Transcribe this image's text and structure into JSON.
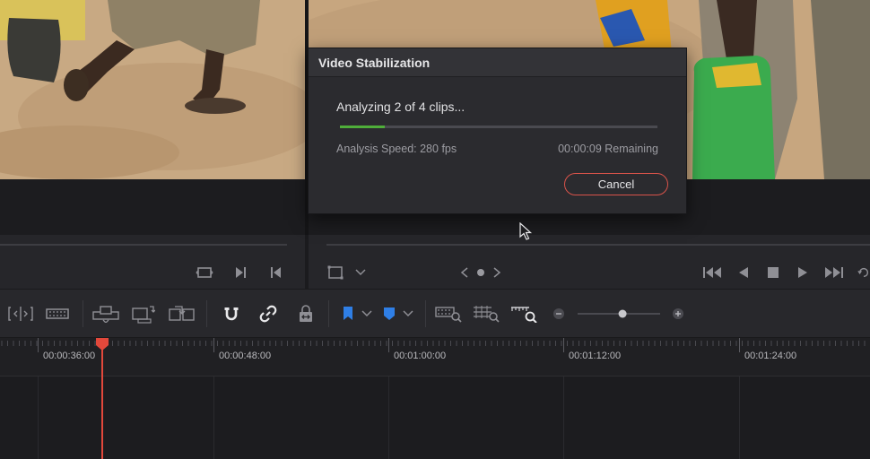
{
  "dialog": {
    "title": "Video Stabilization",
    "status": "Analyzing 2 of 4 clips...",
    "progress_fraction": 0.14,
    "speed_label": "Analysis Speed: 280 fps",
    "remaining_label": "00:00:09 Remaining",
    "cancel_label": "Cancel"
  },
  "source_viewer": {
    "icons": [
      "fit-frame-icon",
      "match-frame-icon",
      "prev-edit-icon"
    ]
  },
  "timeline_viewer": {
    "icons": [
      "transform-icon",
      "chevron-down-icon",
      "prev-arrow-icon",
      "dot-indicator-icon",
      "next-arrow-icon",
      "jump-start-icon",
      "play-reverse-icon",
      "stop-icon",
      "play-icon",
      "jump-end-icon",
      "loop-icon"
    ]
  },
  "toolbar": {
    "icons": [
      "trim-edit-icon",
      "dynamic-trim-icon",
      "insert-clip-icon",
      "overwrite-clip-icon",
      "replace-clip-icon",
      "snapping-icon",
      "linked-selection-icon",
      "position-lock-icon",
      "flag-icon",
      "marker-icon",
      "zoom-full-icon",
      "zoom-detail-icon",
      "zoom-custom-icon",
      "zoom-out-icon",
      "zoom-in-icon"
    ],
    "zoom_level": 0.55,
    "accent": "#2f7fe6"
  },
  "timeline": {
    "timecodes": [
      "00:00:36:00",
      "00:00:48:00",
      "00:01:00:00",
      "00:01:12:00",
      "00:01:24:00"
    ],
    "playhead_color": "#e2483b"
  }
}
